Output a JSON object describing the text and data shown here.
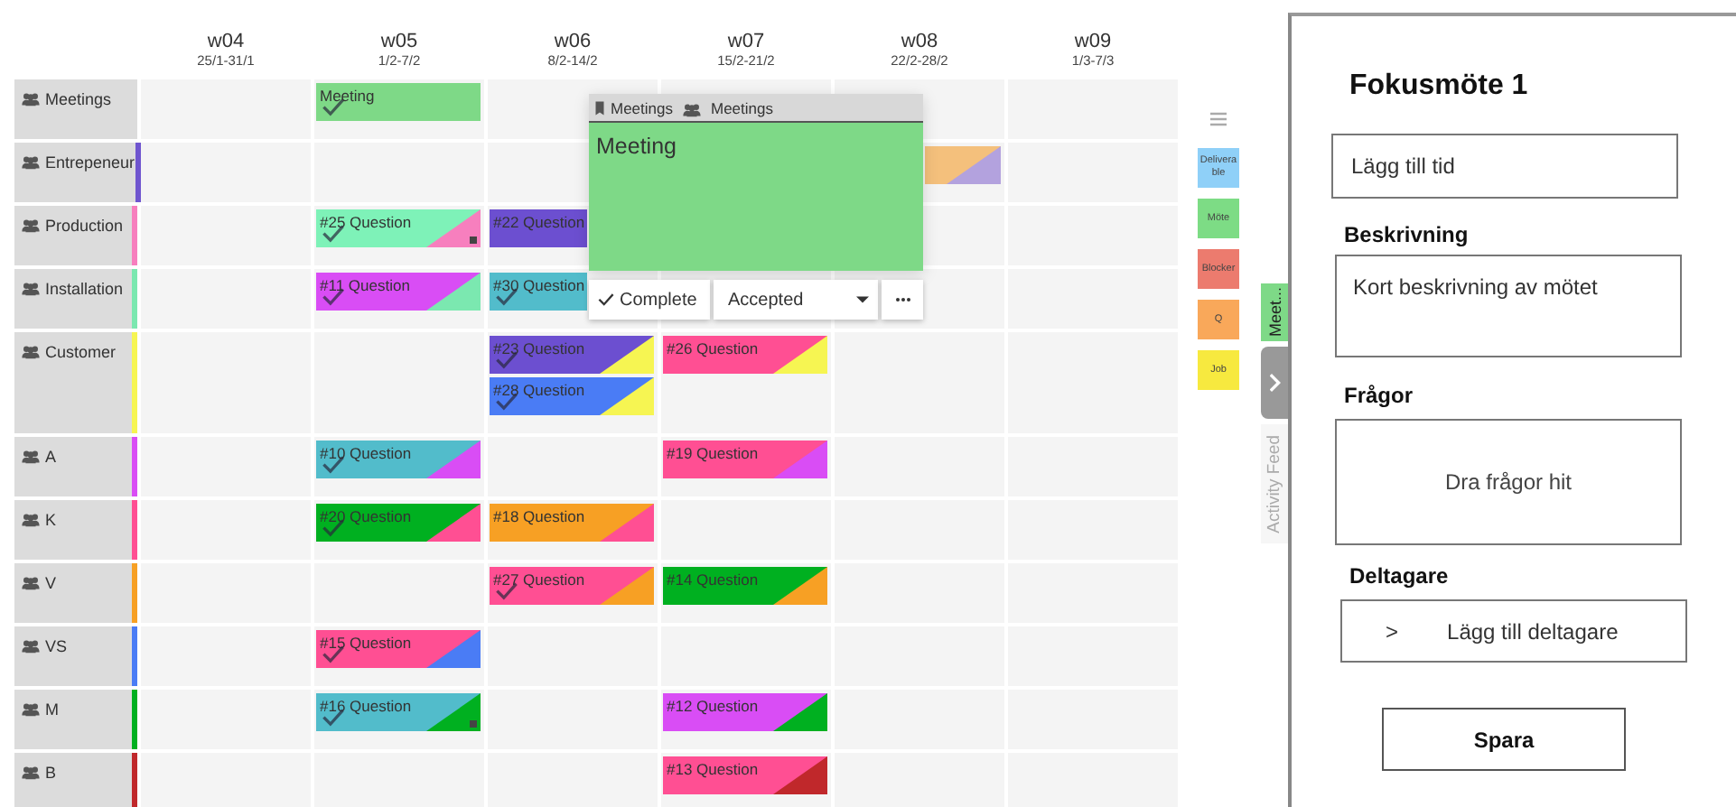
{
  "weeks": [
    {
      "label": "w04",
      "dates": "25/1-31/1"
    },
    {
      "label": "w05",
      "dates": "1/2-7/2"
    },
    {
      "label": "w06",
      "dates": "8/2-14/2"
    },
    {
      "label": "w07",
      "dates": "15/2-21/2"
    },
    {
      "label": "w08",
      "dates": "22/2-28/2"
    },
    {
      "label": "w09",
      "dates": "1/3-7/3"
    }
  ],
  "rows": [
    {
      "name": "Meetings",
      "cells": [
        {
          "kind": "empty"
        },
        {
          "kind": "cards",
          "cards": [
            {
              "title": "Meeting",
              "color": "#7ed987",
              "done": true,
              "dot": false
            }
          ]
        },
        {
          "kind": "empty"
        },
        {
          "kind": "empty"
        },
        {
          "kind": "empty"
        },
        {
          "kind": "empty"
        }
      ]
    },
    {
      "name": "Entrepeneur",
      "color": "#6f55cf",
      "cells": [
        {
          "kind": "empty"
        },
        {
          "kind": "empty"
        },
        {
          "kind": "empty"
        },
        {
          "kind": "empty"
        },
        {
          "kind": "cards",
          "cards": [
            {
              "color": "#f4c07c",
              "corner": {
                "color": "#b3a2de"
              },
              "done": false,
              "dot": false
            }
          ]
        },
        {
          "kind": "empty"
        }
      ]
    },
    {
      "name": "Production",
      "color": "#f77fbe",
      "cells": [
        {
          "kind": "empty"
        },
        {
          "kind": "cards",
          "cards": [
            {
              "title": "#25 Question",
              "color": "#7ef2b8",
              "corner": {
                "color": "#f77fbe"
              },
              "done": true,
              "dot": true
            }
          ]
        },
        {
          "kind": "cards",
          "cards": [
            {
              "title": "#22 Question",
              "color": "#6c4fd0",
              "done": false,
              "dot": false
            }
          ]
        },
        {
          "kind": "empty"
        },
        {
          "kind": "empty"
        },
        {
          "kind": "empty"
        }
      ]
    },
    {
      "name": "Installation",
      "color": "#7be8b0",
      "cells": [
        {
          "kind": "empty"
        },
        {
          "kind": "cards",
          "cards": [
            {
              "title": "#11 Question",
              "color": "#d94df5",
              "corner": {
                "color": "#7be8b0"
              },
              "done": true,
              "dot": false
            }
          ]
        },
        {
          "kind": "cards",
          "cards": [
            {
              "title": "#30 Question",
              "color": "#52bccb",
              "done": true,
              "dot": false
            }
          ]
        },
        {
          "kind": "empty"
        },
        {
          "kind": "empty"
        },
        {
          "kind": "empty"
        }
      ]
    },
    {
      "name": "Customer",
      "color": "#f6f552",
      "cells": [
        {
          "kind": "empty"
        },
        {
          "kind": "empty"
        },
        {
          "kind": "cards",
          "cards": [
            {
              "title": "#23 Question",
              "color": "#6c4fd0",
              "corner": {
                "color": "#f6f552"
              },
              "done": true,
              "dot": false
            },
            {
              "title": "#28 Question",
              "color": "#4a7cf5",
              "corner": {
                "color": "#f6f552"
              },
              "done": true,
              "dot": false
            }
          ]
        },
        {
          "kind": "cards",
          "cards": [
            {
              "title": "#26 Question",
              "color": "#ff4f93",
              "corner": {
                "color": "#f6f552"
              },
              "done": false,
              "dot": false
            }
          ]
        },
        {
          "kind": "empty"
        },
        {
          "kind": "empty"
        }
      ]
    },
    {
      "name": "A",
      "color": "#d94df5",
      "cells": [
        {
          "kind": "empty"
        },
        {
          "kind": "cards",
          "cards": [
            {
              "title": "#10 Question",
              "color": "#52bccb",
              "corner": {
                "color": "#d94df5"
              },
              "done": true,
              "dot": false
            }
          ]
        },
        {
          "kind": "empty"
        },
        {
          "kind": "cards",
          "cards": [
            {
              "title": "#19 Question",
              "color": "#ff4f93",
              "corner": {
                "color": "#d94df5"
              },
              "done": false,
              "dot": false
            }
          ]
        },
        {
          "kind": "empty"
        },
        {
          "kind": "empty"
        }
      ]
    },
    {
      "name": "K",
      "color": "#ff4f93",
      "cells": [
        {
          "kind": "empty"
        },
        {
          "kind": "cards",
          "cards": [
            {
              "title": "#20 Question",
              "color": "#00b020",
              "corner": {
                "color": "#ff4f93"
              },
              "done": true,
              "dot": false
            }
          ]
        },
        {
          "kind": "cards",
          "cards": [
            {
              "title": "#18 Question",
              "color": "#f7a024",
              "corner": {
                "color": "#ff4f93"
              },
              "done": false,
              "dot": false
            }
          ]
        },
        {
          "kind": "empty"
        },
        {
          "kind": "empty"
        },
        {
          "kind": "empty"
        }
      ]
    },
    {
      "name": "V",
      "color": "#f7a024",
      "cells": [
        {
          "kind": "empty"
        },
        {
          "kind": "empty"
        },
        {
          "kind": "cards",
          "cards": [
            {
              "title": "#27 Question",
              "color": "#ff4f93",
              "corner": {
                "color": "#f7a024"
              },
              "done": true,
              "dot": false
            }
          ]
        },
        {
          "kind": "cards",
          "cards": [
            {
              "title": "#14 Question",
              "color": "#00b020",
              "corner": {
                "color": "#f7a024"
              },
              "done": false,
              "dot": false
            }
          ]
        },
        {
          "kind": "empty"
        },
        {
          "kind": "empty"
        }
      ]
    },
    {
      "name": "VS",
      "color": "#4a7cf5",
      "cells": [
        {
          "kind": "empty"
        },
        {
          "kind": "cards",
          "cards": [
            {
              "title": "#15 Question",
              "color": "#ff4f93",
              "corner": {
                "color": "#4a7cf5"
              },
              "done": true,
              "dot": false
            }
          ]
        },
        {
          "kind": "empty"
        },
        {
          "kind": "empty"
        },
        {
          "kind": "empty"
        },
        {
          "kind": "empty"
        }
      ]
    },
    {
      "name": "M",
      "color": "#00b020",
      "cells": [
        {
          "kind": "empty"
        },
        {
          "kind": "cards",
          "cards": [
            {
              "title": "#16 Question",
              "color": "#52bccb",
              "corner": {
                "color": "#00b020"
              },
              "done": true,
              "dot": true
            }
          ]
        },
        {
          "kind": "empty"
        },
        {
          "kind": "cards",
          "cards": [
            {
              "title": "#12 Question",
              "color": "#d94df5",
              "corner": {
                "color": "#00b020"
              },
              "done": false,
              "dot": false
            }
          ]
        },
        {
          "kind": "empty"
        },
        {
          "kind": "empty"
        }
      ]
    },
    {
      "name": "B",
      "color": "#c0282b",
      "cells": [
        {
          "kind": "empty"
        },
        {
          "kind": "empty"
        },
        {
          "kind": "empty"
        },
        {
          "kind": "cards",
          "cards": [
            {
              "title": "#13 Question",
              "color": "#ff4f93",
              "corner": {
                "color": "#c0282b"
              },
              "done": false,
              "dot": false
            }
          ]
        },
        {
          "kind": "empty"
        },
        {
          "kind": "empty"
        }
      ]
    }
  ],
  "popup": {
    "tags": [
      {
        "kind": "board",
        "label": "Meetings"
      },
      {
        "kind": "team",
        "label": "Meetings"
      }
    ],
    "title": "Meeting",
    "color": "#7ed987",
    "complete": "Complete",
    "status": "Accepted"
  },
  "legend": [
    {
      "label": "Deliverable",
      "color": "#8fd0f8"
    },
    {
      "label": "Möte",
      "color": "#7ddc85"
    },
    {
      "label": "Blocker",
      "color": "#ec7b6e"
    },
    {
      "label": "Q",
      "color": "#f9a85a"
    },
    {
      "label": "Job",
      "color": "#f7e93f"
    }
  ],
  "side_tabs": [
    {
      "kind": "card",
      "label": "Meet..."
    },
    {
      "kind": "toggle"
    },
    {
      "kind": "feed",
      "label": "Activity Feed"
    }
  ],
  "panel": {
    "title": "Fokusmöte 1",
    "time_field": {
      "placeholder": "Lägg till tid"
    },
    "description": {
      "label": "Beskrivning",
      "placeholder": "Kort beskrivning av mötet"
    },
    "questions": {
      "label": "Frågor",
      "hint": "Dra frågor hit"
    },
    "participants": {
      "label": "Deltagare",
      "prefix": ">",
      "button": "Lägg till deltagare"
    },
    "save": "Spara"
  }
}
